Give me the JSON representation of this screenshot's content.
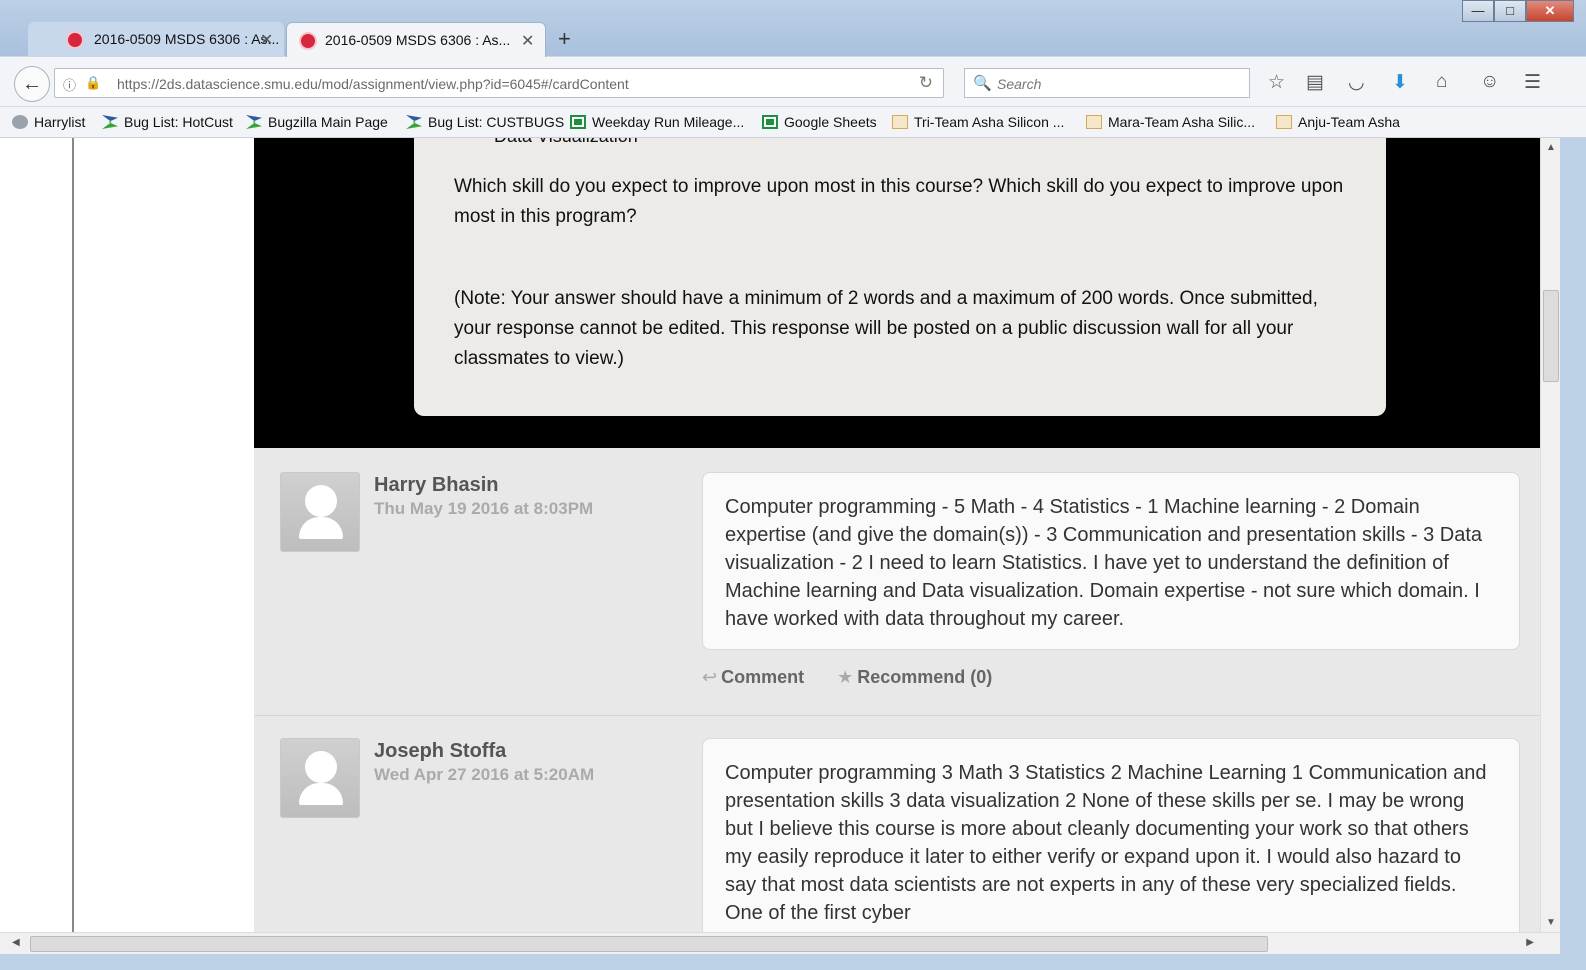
{
  "browser": {
    "tabs": [
      {
        "title": "2016-0509 MSDS 6306 : As...",
        "active": false
      },
      {
        "title": "2016-0509 MSDS 6306 : As...",
        "active": true
      }
    ],
    "new_tab": "+",
    "url": "https://2ds.datascience.smu.edu/mod/assignment/view.php?id=6045#/cardContent",
    "search_placeholder": "Search",
    "window_buttons": {
      "minimize": "—",
      "maximize": "□",
      "close": "✕"
    },
    "bookmarks": [
      {
        "label": "Harrylist",
        "icon": "globe-icon"
      },
      {
        "label": "Bug List: HotCust",
        "icon": "bugzilla-icon"
      },
      {
        "label": "Bugzilla Main Page",
        "icon": "bugzilla-icon"
      },
      {
        "label": "Bug List: CUSTBUGS",
        "icon": "bugzilla-icon"
      },
      {
        "label": "Weekday Run Mileage...",
        "icon": "sheets-icon"
      },
      {
        "label": "Google Sheets",
        "icon": "sheets-icon"
      },
      {
        "label": "Tri-Team Asha Silicon ...",
        "icon": "team-icon"
      },
      {
        "label": "Mara-Team Asha Silic...",
        "icon": "team-icon"
      },
      {
        "label": "Anju-Team Asha",
        "icon": "team-icon"
      }
    ]
  },
  "prompt_card": {
    "cut_off_text": "Data Visualization",
    "question": "Which skill do you expect to improve upon most in this course? Which skill do you expect to improve upon most in this program?",
    "note": "(Note: Your answer should have a minimum of 2 words and a maximum of 200 words. Once submitted, your response cannot be edited. This response will be posted on a public discussion wall for all your classmates to view.)"
  },
  "posts": [
    {
      "author": "Harry Bhasin",
      "date": "Thu May 19 2016 at 8:03PM",
      "body": "Computer programming - 5 Math - 4 Statistics - 1 Machine learning - 2 Domain expertise (and give the domain(s)) - 3 Communication and presentation skills - 3 Data visualization - 2 I need to learn Statistics. I have yet to understand the definition of Machine learning and Data visualization. Domain expertise - not sure which domain. I have worked with data throughout my career.",
      "comment_label": "Comment",
      "recommend_label": "Recommend (0)"
    },
    {
      "author": "Joseph Stoffa",
      "date": "Wed Apr 27 2016 at 5:20AM",
      "body": "Computer programming 3 Math 3 Statistics 2 Machine Learning 1 Communication and presentation skills 3 data visualization 2 None of these skills per se. I may be wrong but I believe this course is more about cleanly documenting your work so that others my easily reproduce it later to either verify or expand upon it. I would also hazard to say that most data scientists are not experts in any of these very specialized fields. One of the first cyber"
    }
  ]
}
